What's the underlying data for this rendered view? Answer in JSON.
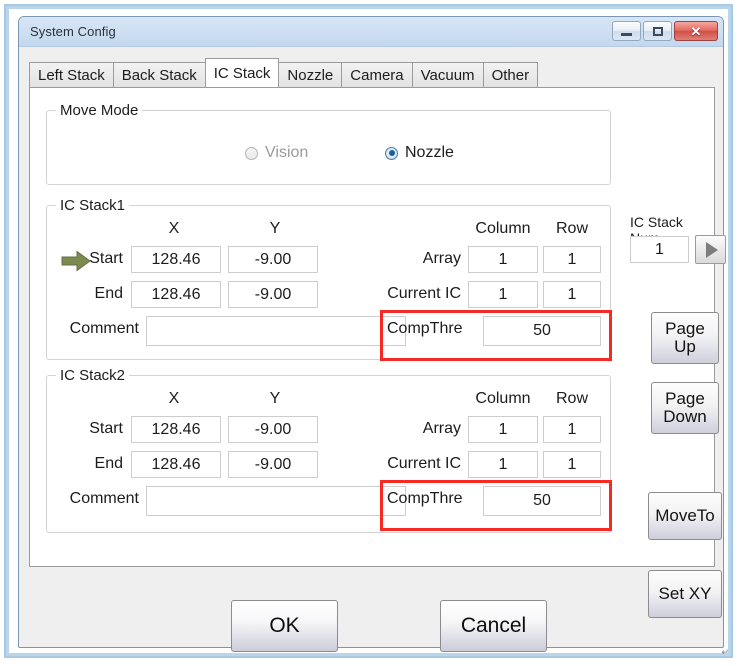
{
  "window": {
    "title": "System Config",
    "controls": {
      "minimize": "minimize-button",
      "maximize": "maximize-button",
      "close": "✕"
    }
  },
  "tabs": [
    {
      "label": "Left Stack",
      "active": false
    },
    {
      "label": "Back Stack",
      "active": false
    },
    {
      "label": "IC Stack",
      "active": true
    },
    {
      "label": "Nozzle",
      "active": false
    },
    {
      "label": "Camera",
      "active": false
    },
    {
      "label": "Vacuum",
      "active": false
    },
    {
      "label": "Other",
      "active": false
    }
  ],
  "move_mode": {
    "title": "Move Mode",
    "options": [
      {
        "label": "Vision",
        "selected": false,
        "disabled": true
      },
      {
        "label": "Nozzle",
        "selected": true,
        "disabled": false
      }
    ]
  },
  "ic_stack_num": {
    "label": "IC Stack Num",
    "value": "1",
    "next_button": "next-arrow"
  },
  "headers": {
    "x": "X",
    "y": "Y",
    "column": "Column",
    "row": "Row"
  },
  "labels": {
    "start": "Start",
    "end": "End",
    "comment": "Comment",
    "array": "Array",
    "current_ic": "Current IC",
    "comp_thre": "CompThre"
  },
  "stack1": {
    "title": "IC Stack1",
    "has_arrow": true,
    "start": {
      "x": "128.46",
      "y": "-9.00"
    },
    "end": {
      "x": "128.46",
      "y": "-9.00"
    },
    "comment": "",
    "array": {
      "column": "1",
      "row": "1"
    },
    "current_ic": {
      "column": "1",
      "row": "1"
    },
    "comp_thre": "50"
  },
  "stack2": {
    "title": "IC Stack2",
    "has_arrow": false,
    "start": {
      "x": "128.46",
      "y": "-9.00"
    },
    "end": {
      "x": "128.46",
      "y": "-9.00"
    },
    "comment": "",
    "array": {
      "column": "1",
      "row": "1"
    },
    "current_ic": {
      "column": "1",
      "row": "1"
    },
    "comp_thre": "50"
  },
  "side_buttons": {
    "page_up_line1": "Page",
    "page_up_line2": "Up",
    "page_down_line1": "Page",
    "page_down_line2": "Down",
    "move_to": "MoveTo",
    "set_xy": "Set XY"
  },
  "dialog_buttons": {
    "ok": "OK",
    "cancel": "Cancel"
  },
  "annotations": {
    "highlight_color": "#f52a22",
    "count": 2
  },
  "bottom_mark": "↵",
  "colors": {
    "titlebar": "#cfe0f2",
    "dialog_bg": "#efefef",
    "page_bg": "#ffffff",
    "accent_red": "#f52a22",
    "arrow_green": "#7d8a52",
    "radio_blue": "#1c5f96",
    "frame_blue": "#b9d5ec"
  }
}
